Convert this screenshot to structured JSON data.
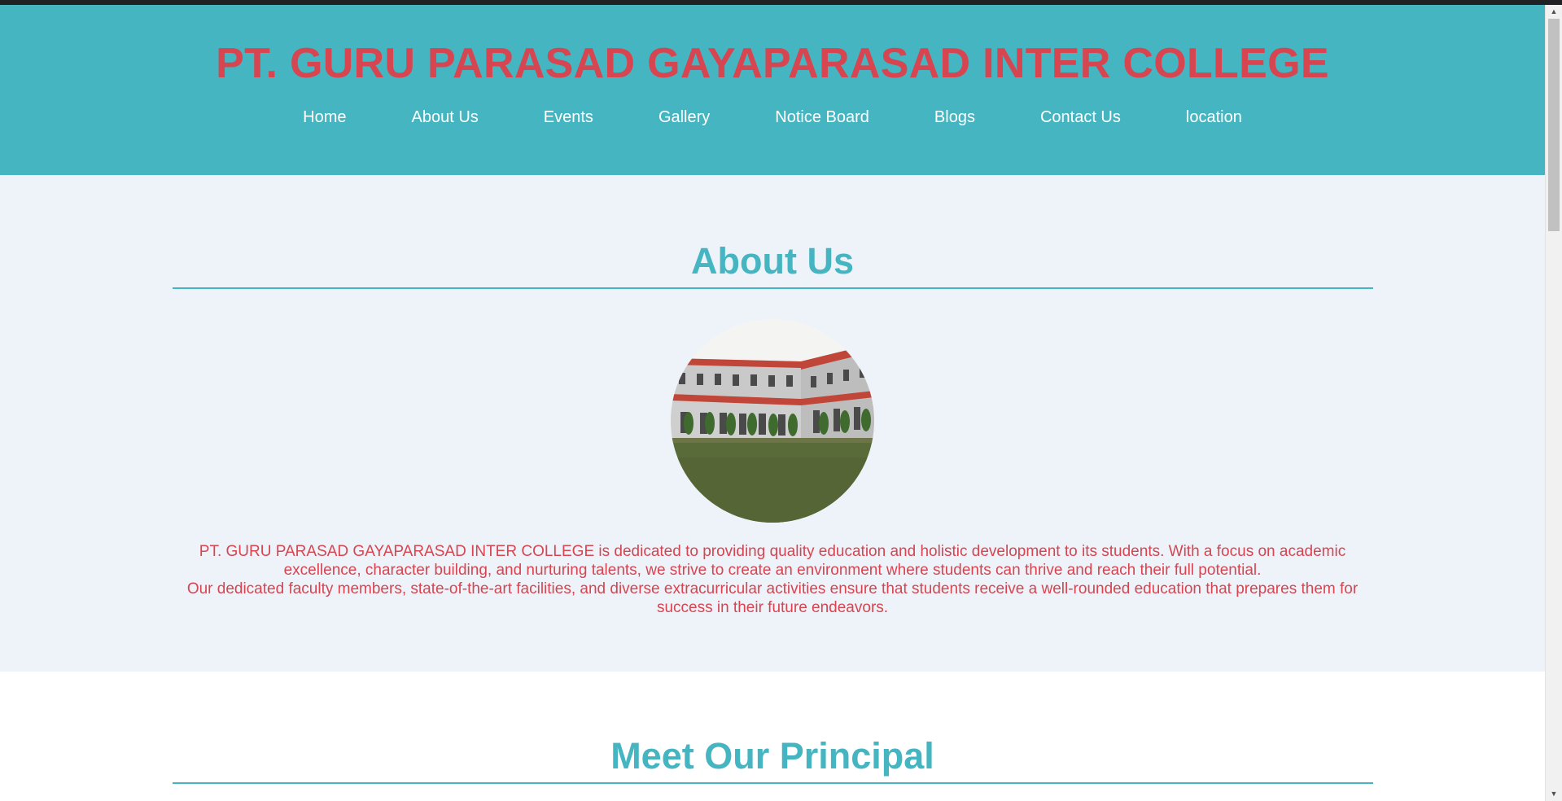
{
  "header": {
    "title": "PT. GURU PARASAD GAYAPARASAD INTER COLLEGE",
    "nav": [
      {
        "label": "Home"
      },
      {
        "label": "About Us"
      },
      {
        "label": "Events"
      },
      {
        "label": "Gallery"
      },
      {
        "label": "Notice Board"
      },
      {
        "label": "Blogs"
      },
      {
        "label": "Contact Us"
      },
      {
        "label": "location"
      }
    ]
  },
  "about": {
    "heading": "About Us",
    "paragraph1": "PT. GURU PARASAD GAYAPARASAD INTER COLLEGE is dedicated to providing quality education and holistic development to its students. With a focus on academic excellence, character building, and nurturing talents, we strive to create an environment where students can thrive and reach their full potential.",
    "paragraph2": "Our dedicated faculty members, state-of-the-art facilities, and diverse extracurricular activities ensure that students receive a well-rounded education that prepares them for success in their future endeavors."
  },
  "principal": {
    "heading": "Meet Our Principal"
  },
  "colors": {
    "accent": "#45b5c1",
    "title_red": "#d64550",
    "about_bg": "#eef2f9"
  },
  "scrollbar": {
    "up_icon": "triangle-up-icon",
    "down_icon": "triangle-down-icon"
  }
}
